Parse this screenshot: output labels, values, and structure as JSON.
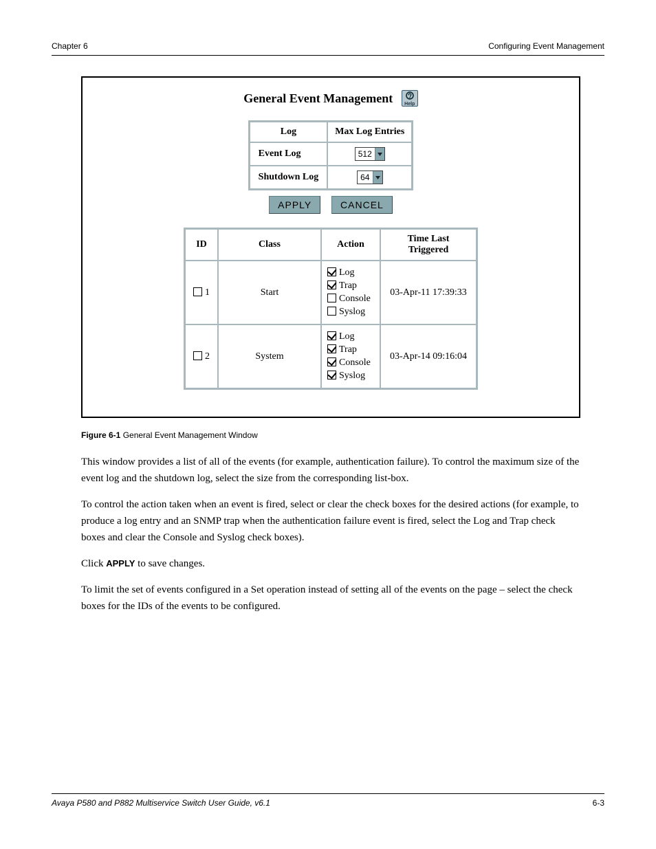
{
  "header": {
    "left": "Chapter 6",
    "right": "Configuring Event Management"
  },
  "panel": {
    "title": "General Event Management",
    "help_label": "Help",
    "apply_label": "APPLY",
    "cancel_label": "CANCEL"
  },
  "log_settings": {
    "headers": {
      "log": "Log",
      "max": "Max Log Entries"
    },
    "rows": [
      {
        "label": "Event Log",
        "value": "512"
      },
      {
        "label": "Shutdown Log",
        "value": "64"
      }
    ]
  },
  "event_table": {
    "headers": {
      "id": "ID",
      "class": "Class",
      "action": "Action",
      "time": "Time Last Triggered"
    },
    "rows": [
      {
        "id": "1",
        "class": "Start",
        "actions": {
          "log": true,
          "trap": true,
          "console": false,
          "syslog": false
        },
        "time": "03-Apr-11 17:39:33"
      },
      {
        "id": "2",
        "class": "System",
        "actions": {
          "log": true,
          "trap": true,
          "console": true,
          "syslog": true
        },
        "time": "03-Apr-14 09:16:04"
      }
    ]
  },
  "action_labels": {
    "log": "Log",
    "trap": "Trap",
    "console": "Console",
    "syslog": "Syslog"
  },
  "caption": {
    "fig_label": "Figure 6-1",
    "fig_text": " General Event Management Window"
  },
  "description": {
    "p1": "This window provides a list of all of the events (for example, authentication failure). To control the maximum size of the event log and the shutdown log, select the size from the corresponding list-box.",
    "p2": "To control the action taken when an event is fired, select or clear the check boxes for the desired actions (for example, to produce a log entry and an SNMP trap when the authentication failure event is fired, select the Log and Trap check boxes and clear the Console and Syslog check boxes).",
    "apply_word": "APPLY",
    "p3_after": " to save changes.",
    "p4": "To limit the set of events configured in a Set operation instead of setting all of the events on the page – select the check boxes for the IDs of the events to be configured."
  },
  "footer": {
    "left": "Avaya P580 and P882 Multiservice Switch User Guide, v6.1",
    "right": "6-3"
  }
}
